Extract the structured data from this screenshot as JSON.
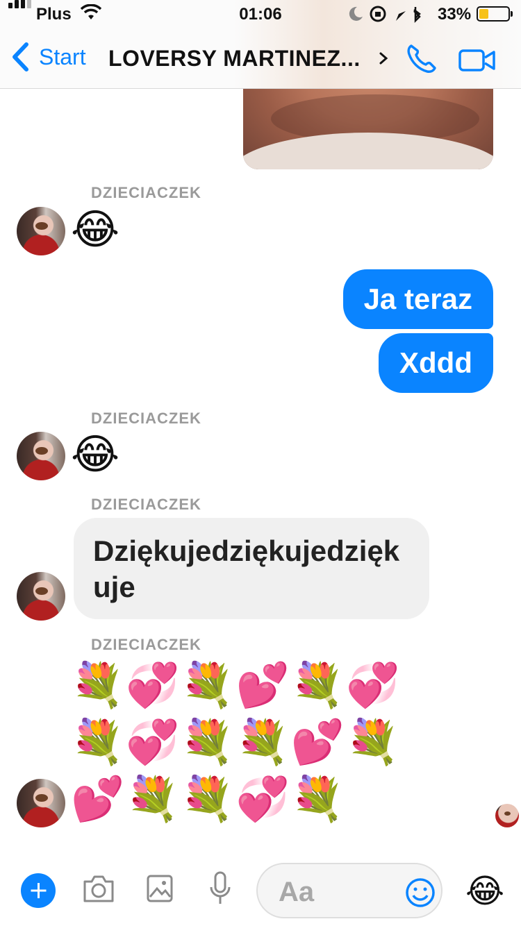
{
  "status_bar": {
    "carrier": "Plus",
    "time": "01:06",
    "battery_percent": "33%",
    "battery_level": 0.33
  },
  "nav": {
    "back_label": "Start",
    "title": "LOVERSY MARTINEZ..."
  },
  "messages": {
    "sender_1": "DZIECIACZEK",
    "emoji_1": "😂",
    "out_1": "Ja teraz",
    "out_2": "Xddd",
    "sender_2": "DZIECIACZEK",
    "emoji_2": "😂",
    "sender_3": "DZIECIACZEK",
    "text_in": "Dziękujedziękujedziękuje",
    "sender_4": "DZIECIACZEK",
    "flowers_row_1": "💐💞💐💕💐💞",
    "flowers_row_2": "💐💞💐💐💕💐",
    "flowers_row_3": "💕💐💐💞💐"
  },
  "composer": {
    "placeholder": "Aa",
    "quick_emoji": "😂"
  },
  "icons": [
    "back-chevron-icon",
    "phone-icon",
    "video-camera-icon",
    "plus-icon",
    "camera-icon",
    "image-icon",
    "microphone-icon",
    "smiley-icon"
  ],
  "colors": {
    "accent": "#0a84ff",
    "incoming_bubble": "#f0f0f0",
    "sender_label": "#9a9a9a"
  }
}
